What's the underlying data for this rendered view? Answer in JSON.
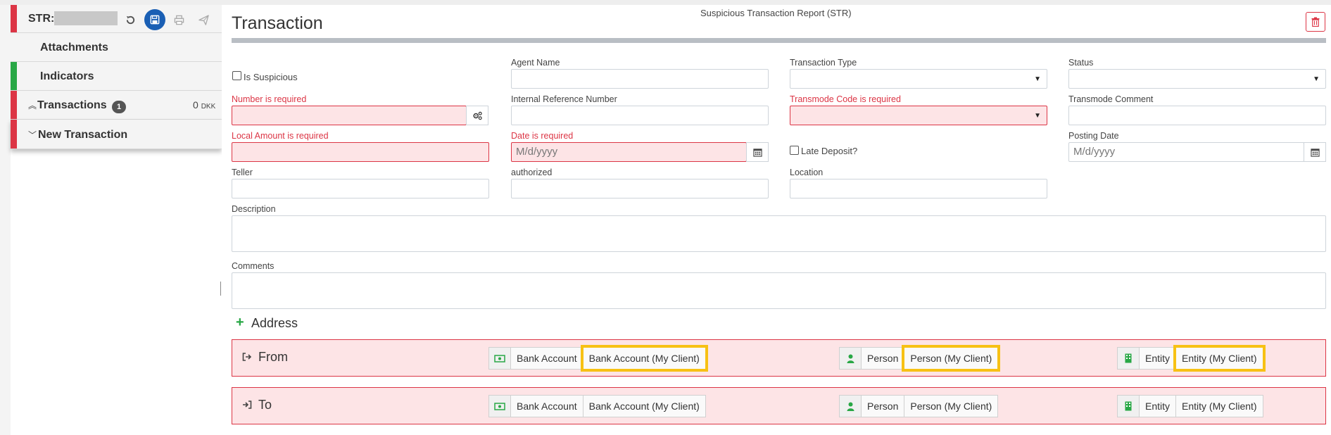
{
  "sidebar": {
    "str_label": "STR:",
    "attachments_label": "Attachments",
    "indicators_label": "Indicators",
    "transactions_label": "Transactions",
    "transactions_count": "1",
    "transactions_amount": "0",
    "transactions_currency": "DKK",
    "new_transaction_label": "New Transaction"
  },
  "main": {
    "page_title": "Transaction",
    "report_title": "Suspicious Transaction Report (STR)"
  },
  "form": {
    "is_suspicious_label": "Is Suspicious",
    "agent_name_label": "Agent Name",
    "transaction_type_label": "Transaction Type",
    "status_label": "Status",
    "number_label": "Number is required",
    "internal_ref_label": "Internal Reference Number",
    "transmode_code_label": "Transmode Code is required",
    "transmode_comment_label": "Transmode Comment",
    "local_amount_label": "Local Amount is required",
    "date_label": "Date is required",
    "date_placeholder": "M/d/yyyy",
    "late_deposit_label": "Late Deposit?",
    "posting_date_label": "Posting Date",
    "posting_date_placeholder": "M/d/yyyy",
    "teller_label": "Teller",
    "authorized_label": "authorized",
    "location_label": "Location",
    "description_label": "Description",
    "comments_label": "Comments"
  },
  "address": {
    "label": "Address"
  },
  "parties": {
    "from": {
      "label": "From",
      "bank_account": "Bank Account",
      "bank_account_my_client": "Bank Account (My Client)",
      "person": "Person",
      "person_my_client": "Person (My Client)",
      "entity": "Entity",
      "entity_my_client": "Entity (My Client)"
    },
    "to": {
      "label": "To",
      "bank_account": "Bank Account",
      "bank_account_my_client": "Bank Account (My Client)",
      "person": "Person",
      "person_my_client": "Person (My Client)",
      "entity": "Entity",
      "entity_my_client": "Entity (My Client)"
    }
  },
  "colors": {
    "error": "#dc3545",
    "success": "#28a745",
    "primary": "#1a5fb4",
    "highlight": "#f7c114",
    "error_bg": "#fde4e6"
  }
}
